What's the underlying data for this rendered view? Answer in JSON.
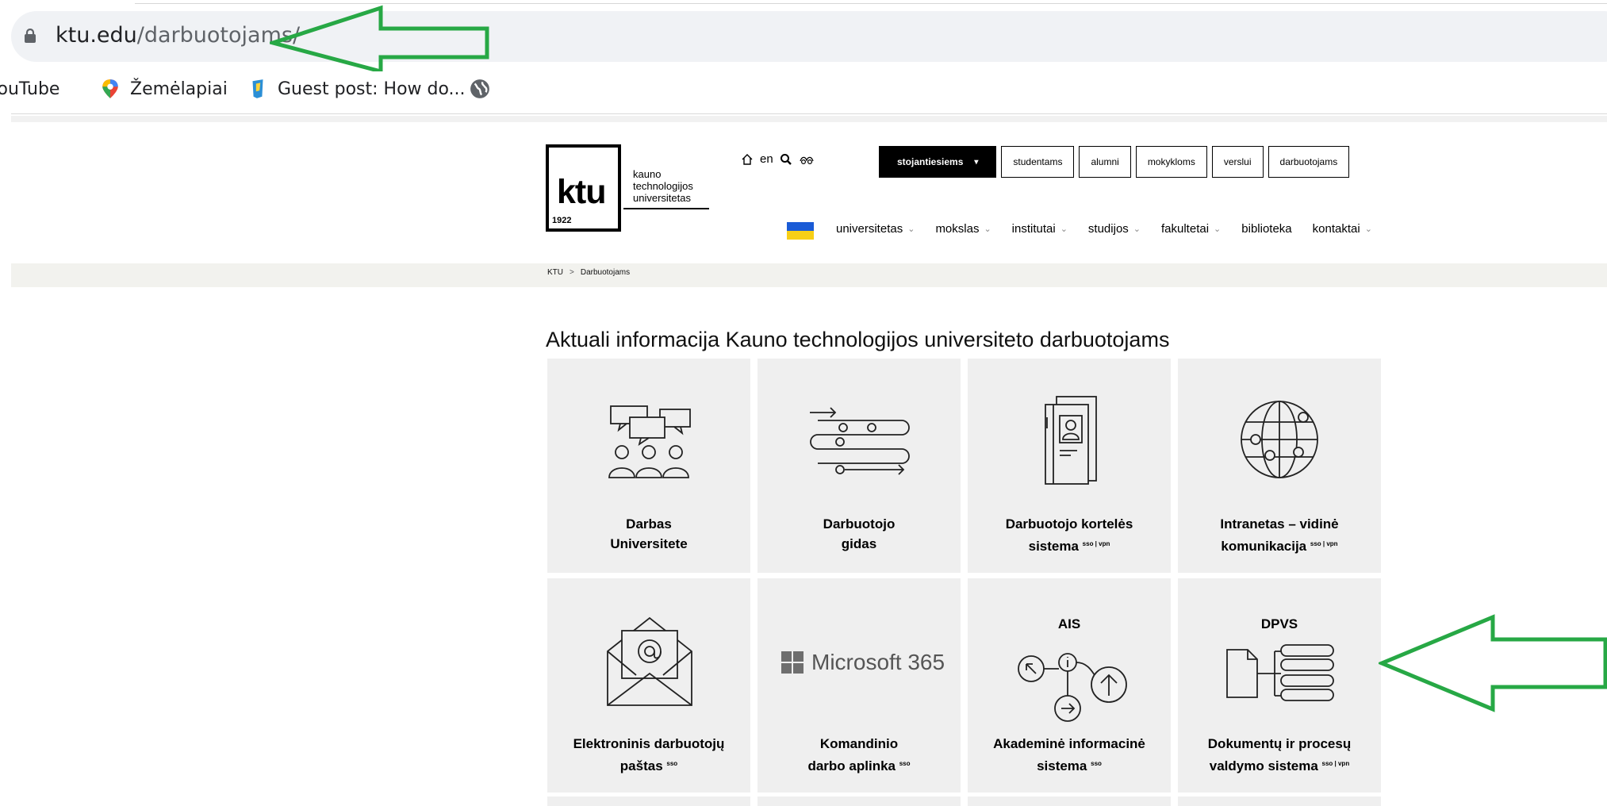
{
  "browser": {
    "url_host": "ktu.edu",
    "url_path": "/darbuotojams/",
    "bookmarks": [
      {
        "label": "YouTube",
        "icon": "youtube-icon"
      },
      {
        "label": "Žemėlapiai",
        "icon": "maps-pin-icon"
      },
      {
        "label": "Guest post: How do...",
        "icon": "bookmark-icon"
      },
      {
        "label": "",
        "icon": "globe-icon"
      }
    ]
  },
  "logo": {
    "mark": "ktu",
    "year": "1922",
    "line1": "kauno",
    "line2": "technologijos",
    "line3": "universitetas"
  },
  "util": {
    "lang": "en"
  },
  "top_nav": [
    "stojantiesiems",
    "studentams",
    "alumni",
    "mokykloms",
    "verslui",
    "darbuotojams"
  ],
  "main_nav": [
    {
      "label": "universitetas",
      "dropdown": true
    },
    {
      "label": "mokslas",
      "dropdown": true
    },
    {
      "label": "institutai",
      "dropdown": true
    },
    {
      "label": "studijos",
      "dropdown": true
    },
    {
      "label": "fakultetai",
      "dropdown": true
    },
    {
      "label": "biblioteka",
      "dropdown": false
    },
    {
      "label": "kontaktai",
      "dropdown": true
    }
  ],
  "breadcrumb": {
    "home": "KTU",
    "current": "Darbuotojams"
  },
  "heading": "Aktuali informacija Kauno technologijos universiteto darbuotojams",
  "tiles": [
    {
      "line1": "Darbas",
      "line2": "Universitete",
      "sup": "",
      "icon": "people-chat-icon"
    },
    {
      "line1": "Darbuotojo",
      "line2": "gidas",
      "sup": "",
      "icon": "guide-path-icon"
    },
    {
      "line1": "Darbuotojo kortelės",
      "line2": "sistema",
      "sup": "sso | vpn",
      "icon": "id-card-icon"
    },
    {
      "line1": "Intranetas – vidinė",
      "line2": "komunikacija",
      "sup": "sso | vpn",
      "icon": "globe-network-icon"
    },
    {
      "line1": "Elektroninis darbuotojų",
      "line2": "paštas",
      "sup": "sso",
      "icon": "email-envelope-icon"
    },
    {
      "line1": "Komandinio",
      "line2": "darbo aplinka",
      "sup": "sso",
      "icon": "microsoft365-logo",
      "logo_text": "Microsoft 365"
    },
    {
      "line1": "Akademinė informacinė",
      "line2": "sistema",
      "sup": "sso",
      "icon": "info-network-icon",
      "top_text": "AIS"
    },
    {
      "line1": "Dokumentų ir procesų",
      "line2": "valdymo sistema",
      "sup": "sso | vpn",
      "icon": "document-flow-icon",
      "top_text": "DPVS"
    }
  ],
  "colors": {
    "arrow": "#27a845",
    "tile_bg": "#efefef",
    "accent": "#000000"
  }
}
